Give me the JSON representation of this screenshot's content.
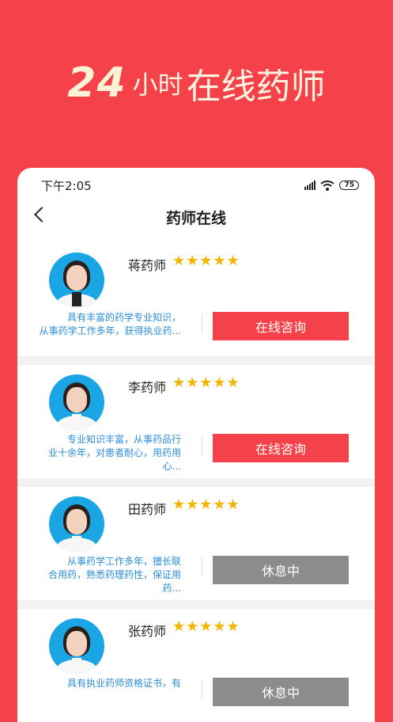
{
  "hero": {
    "number": "24",
    "small": "小时",
    "big": "在线药师"
  },
  "status_bar": {
    "time": "下午2:05",
    "battery": "75"
  },
  "nav": {
    "title": "药师在线"
  },
  "pharmacists": [
    {
      "name": "蒋药师",
      "stars": "★★★★★",
      "desc": [
        "具有丰富的药学专业知识，",
        "从事药学工作多年，获得执业药..."
      ],
      "button": "在线咨询",
      "status": "online"
    },
    {
      "name": "李药师",
      "stars": "★★★★★",
      "desc": [
        "专业知识丰富，从事药品行",
        "业十余年，对患者耐心，用药用心..."
      ],
      "button": "在线咨询",
      "status": "online"
    },
    {
      "name": "田药师",
      "stars": "★★★★★",
      "desc": [
        "从事药学工作多年，擅长联",
        "合用药，熟悉药理药性，保证用药..."
      ],
      "button": "休息中",
      "status": "rest"
    },
    {
      "name": "张药师",
      "stars": "★★★★★",
      "desc": [
        "具有执业药师资格证书，有",
        ""
      ],
      "button": "休息中",
      "status": "rest"
    }
  ]
}
